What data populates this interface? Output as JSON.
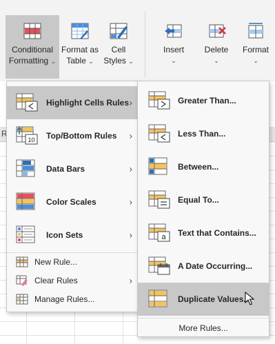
{
  "ribbon": {
    "conditional_formatting": {
      "line1": "Conditional",
      "line2": "Formatting",
      "chevron": "⌄",
      "icon": "conditional-formatting-icon"
    },
    "format_as_table": {
      "line1": "Format as",
      "line2": "Table",
      "chevron": "⌄",
      "icon": "format-as-table-icon"
    },
    "cell_styles": {
      "line1": "Cell",
      "line2": "Styles",
      "chevron": "⌄",
      "icon": "cell-styles-icon"
    },
    "insert": {
      "label": "Insert",
      "chevron": "⌄",
      "icon": "insert-cells-icon"
    },
    "delete": {
      "label": "Delete",
      "chevron": "⌄",
      "icon": "delete-cells-icon"
    },
    "format": {
      "label": "Format",
      "chevron": "⌄",
      "icon": "format-cells-icon"
    }
  },
  "sheet": {
    "col_header_fragment": "R",
    "scroll_arrow": "‹"
  },
  "main_menu": {
    "items": [
      {
        "label": "Highlight Cells Rules",
        "icon": "highlight-cells-rules-icon",
        "has_submenu": true,
        "highlighted": true
      },
      {
        "label": "Top/Bottom Rules",
        "icon": "top-bottom-rules-icon",
        "has_submenu": true
      },
      {
        "label": "Data Bars",
        "icon": "data-bars-icon",
        "has_submenu": true
      },
      {
        "label": "Color Scales",
        "icon": "color-scales-icon",
        "has_submenu": true
      },
      {
        "label": "Icon Sets",
        "icon": "icon-sets-icon",
        "has_submenu": true
      }
    ],
    "small_items": [
      {
        "label": "New Rule...",
        "icon": "new-rule-icon"
      },
      {
        "label": "Clear Rules",
        "icon": "clear-rules-icon",
        "has_submenu": true
      },
      {
        "label": "Manage Rules...",
        "icon": "manage-rules-icon"
      }
    ],
    "submenu_arrow": "›"
  },
  "submenu": {
    "items": [
      {
        "label": "Greater Than...",
        "icon": "greater-than-icon"
      },
      {
        "label": "Less Than...",
        "icon": "less-than-icon"
      },
      {
        "label": "Between...",
        "icon": "between-icon"
      },
      {
        "label": "Equal To...",
        "icon": "equal-to-icon"
      },
      {
        "label": "Text that Contains...",
        "icon": "text-contains-icon"
      },
      {
        "label": "A Date Occurring...",
        "icon": "date-occurring-icon"
      },
      {
        "label": "Duplicate Values...",
        "icon": "duplicate-values-icon",
        "highlighted": true
      }
    ],
    "more_rules": "More Rules...",
    "ten_badge": "10",
    "a_badge": "a"
  },
  "colors": {
    "accent_blue": "#1f6fc5",
    "accent_red": "#d13438",
    "yellow": "#f5c35c",
    "menu_hover": "#c8c8c8",
    "ribbon_active": "#c8c8c8"
  }
}
